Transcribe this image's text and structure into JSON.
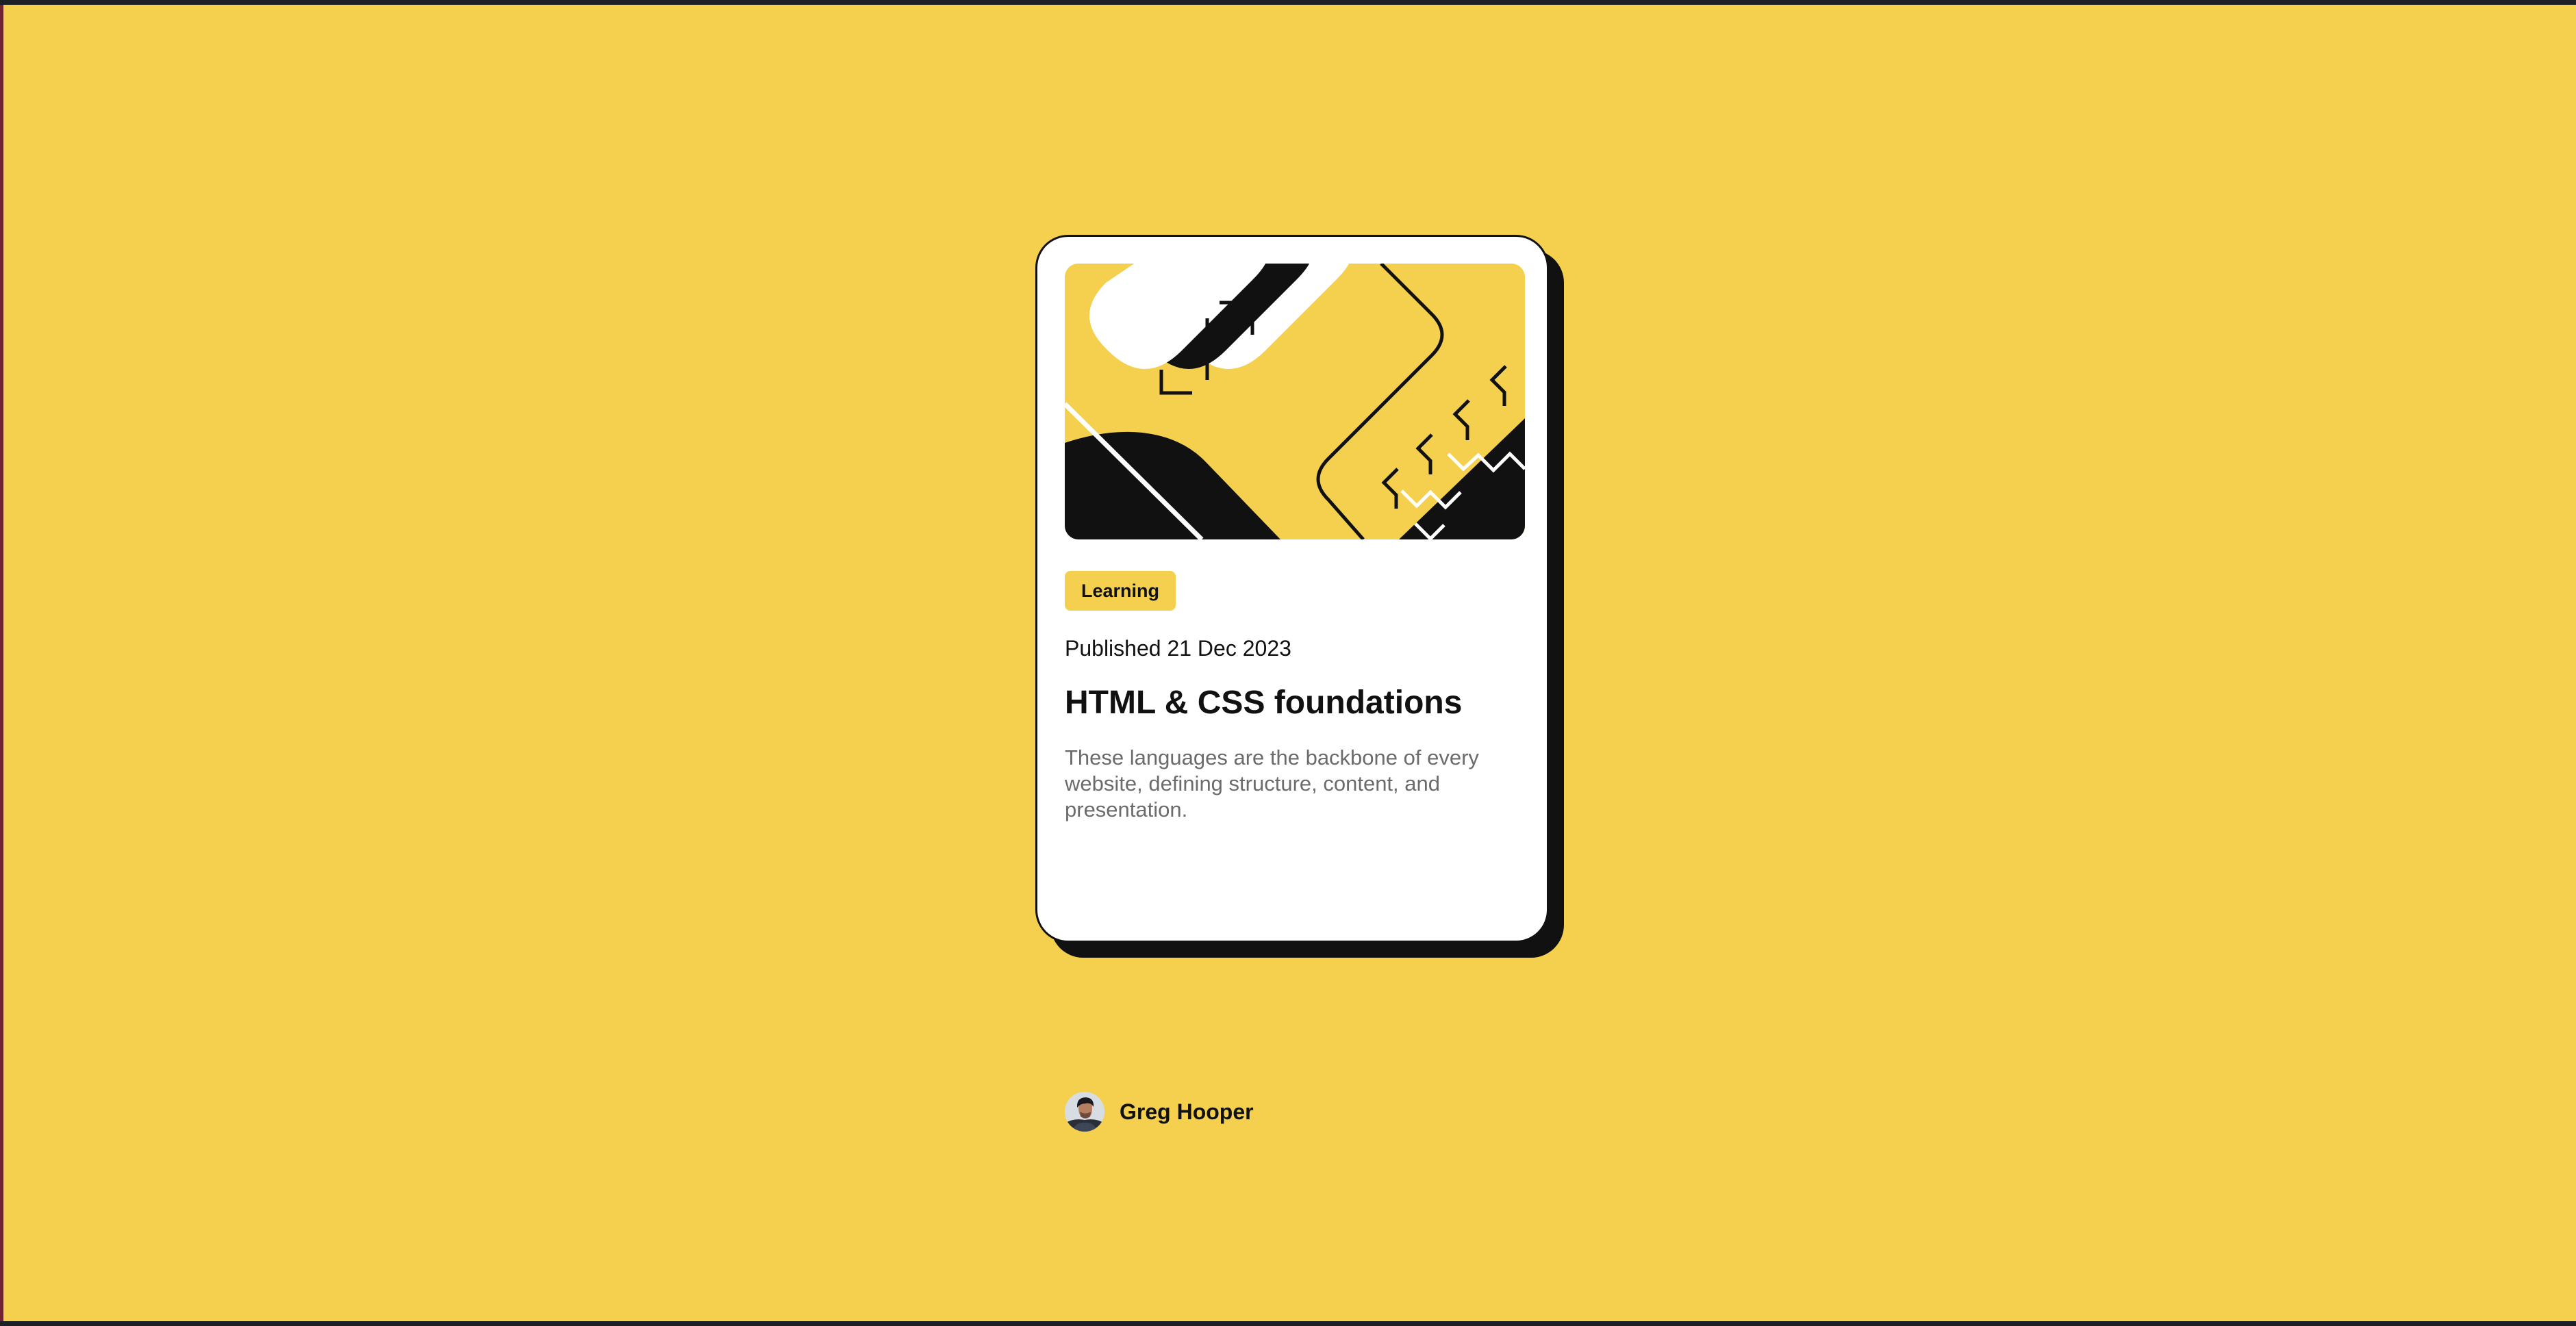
{
  "card": {
    "tag": "Learning",
    "published": "Published 21 Dec 2023",
    "title": "HTML & CSS foundations",
    "description": "These languages are the backbone of every website, defining structure, content, and presentation.",
    "author": {
      "name": "Greg Hooper",
      "avatar_icon": "user-avatar-icon"
    },
    "illustration_icon": "abstract-code-illustration-icon"
  },
  "colors": {
    "background": "#f4d04e",
    "card": "#ffffff",
    "text": "#111111",
    "muted_text": "#6b6b6b",
    "tag_background": "#f4d04e"
  }
}
